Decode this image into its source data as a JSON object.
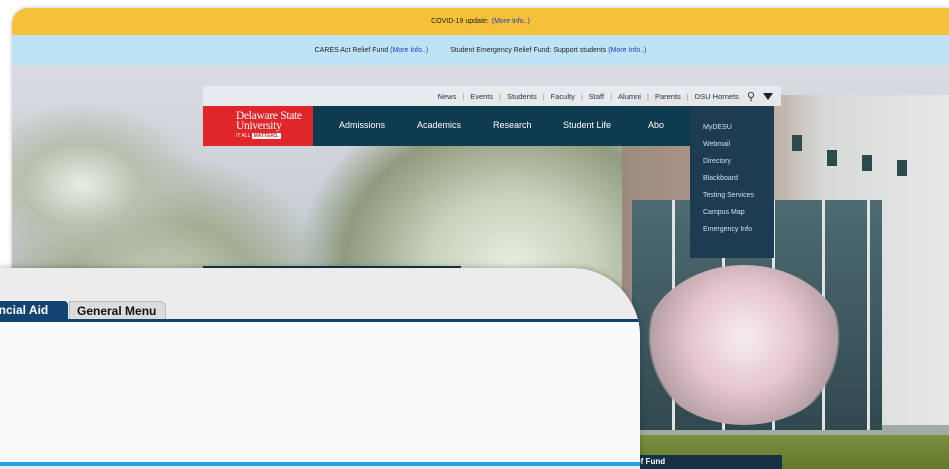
{
  "back_window": {
    "covid_banner": {
      "text": "COVID-19 update:",
      "link": "(More Info..)"
    },
    "relief_banner": {
      "item1_text": "CARES Act Relief Fund",
      "item1_link": "(More Info..)",
      "item2_text": "Student Emergency Relief Fund: Support students",
      "item2_link": "(More Info..)"
    },
    "top_links": [
      "News",
      "Events",
      "Students",
      "Faculty",
      "Staff",
      "Alumni",
      "Parents",
      "DSU Hornets"
    ],
    "logo": {
      "line1": "Delaware State",
      "line2": "University",
      "tagline_prefix": "IT ALL",
      "tagline_badge": "MATTERS."
    },
    "main_nav": [
      "Admissions",
      "Academics",
      "Research",
      "Student Life",
      "Abo"
    ],
    "dropdown": [
      "MyDESU",
      "Webmail",
      "Directory",
      "Blackboard",
      "Testing Services",
      "Campus Map",
      "Emergency Info"
    ],
    "footer_fragment": "lef Fund",
    "colors": {
      "covid": "#f6c13a",
      "relief": "#bfe3f6",
      "dsu_red": "#e0262b",
      "dsu_navy": "#0e3b4e"
    }
  },
  "front_window": {
    "tabs": [
      "ancial Aid",
      "General Menu"
    ],
    "colors": {
      "tab_active": "#134471",
      "accent": "#22a6df"
    }
  }
}
